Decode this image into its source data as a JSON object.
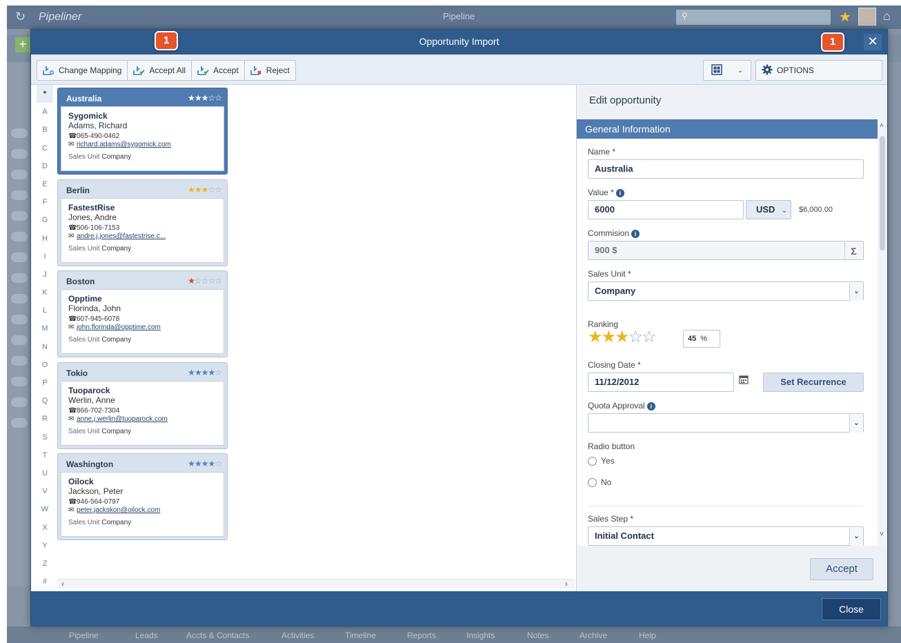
{
  "background": {
    "logo": "Pipeliner",
    "window_title": "Pipeline",
    "nav": [
      "Pipeline",
      "Leads",
      "Accts & Contacts",
      "Activities",
      "Timeline",
      "Reports",
      "Insights",
      "Notes",
      "Archive",
      "Help"
    ]
  },
  "modal": {
    "title": "Opportunity Import",
    "close_icon": "✕"
  },
  "toolbar": {
    "change_mapping": "Change Mapping",
    "accept_all": "Accept All",
    "accept": "Accept",
    "reject": "Reject",
    "options": "OPTIONS"
  },
  "alphabet": [
    "*",
    "A",
    "B",
    "C",
    "D",
    "E",
    "F",
    "G",
    "H",
    "I",
    "J",
    "K",
    "L",
    "M",
    "N",
    "O",
    "P",
    "Q",
    "R",
    "S",
    "T",
    "U",
    "V",
    "W",
    "X",
    "Y",
    "Z",
    "#"
  ],
  "cards": [
    {
      "name": "Australia",
      "rating": 3,
      "star_color": "#ffffff",
      "company": "Sygomick",
      "contact": "Adams, Richard",
      "phone": "065-490-0462",
      "email": "richard.adams@sygomick.com",
      "unit_label": "Sales Unit",
      "unit_value": "Company"
    },
    {
      "name": "Berlin",
      "rating": 3,
      "star_color": "#f0b323",
      "company": "FastestRise",
      "contact": "Jones, Andre",
      "phone": "506-106-7153",
      "email": "andre.j.jones@fastestrise.c...",
      "unit_label": "Sales Unit",
      "unit_value": "Company"
    },
    {
      "name": "Boston",
      "rating": 1,
      "star_color": "#e04a22",
      "company": "Opptime",
      "contact": "Florinda, John",
      "phone": "607-945-6078",
      "email": "john.florinda@opptime.com",
      "unit_label": "Sales Unit",
      "unit_value": "Company"
    },
    {
      "name": "Tokio",
      "rating": 4,
      "star_color": "#4a86c5",
      "company": "Tuoparock",
      "contact": "Werlin, Anne",
      "phone": "866-702-7304",
      "email": "anne.j.werlin@tuoparock.com",
      "unit_label": "Sales Unit",
      "unit_value": "Company"
    },
    {
      "name": "Washington",
      "rating": 4,
      "star_color": "#4a86c5",
      "company": "Oilock",
      "contact": "Jackson, Peter",
      "phone": "946-564-0797",
      "email": "peter.jackskon@oilock.com",
      "unit_label": "Sales Unit",
      "unit_value": "Company"
    }
  ],
  "edit": {
    "title": "Edit opportunity",
    "section": "General Information",
    "name_label": "Name *",
    "name_value": "Australia",
    "value_label": "Value *",
    "value_value": "6000",
    "currency": "USD",
    "value_formatted": "$6,000.00",
    "commission_label": "Commision",
    "commission_value": "900 $",
    "sales_unit_label": "Sales Unit *",
    "sales_unit_value": "Company",
    "ranking_label": "Ranking",
    "ranking_stars": 3,
    "ranking_percent": "45",
    "ranking_percent_sign": "%",
    "closing_label": "Closing Date *",
    "closing_value": "11/12/2012",
    "recurrence_button": "Set Recurrence",
    "quota_label": "Quota Approval",
    "radio_label": "Radio button",
    "radio_yes": "Yes",
    "radio_no": "No",
    "sales_step_label": "Sales Step *",
    "sales_step_value": "Initial Contact",
    "accept_button": "Accept"
  },
  "footer": {
    "close_button": "Close"
  },
  "badges": [
    "1",
    "1"
  ],
  "colors": {
    "header": "#2f5b8d",
    "selected_card": "#4f7bb0",
    "badge": "#e5552e",
    "rank_star": "#f0b323"
  }
}
